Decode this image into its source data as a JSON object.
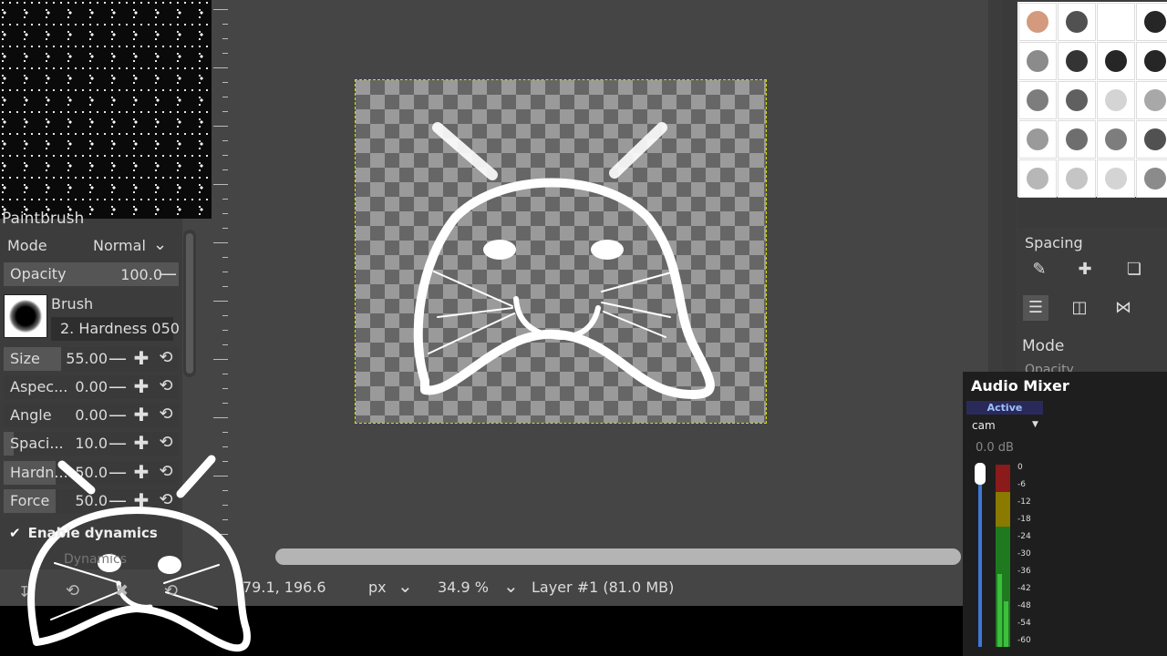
{
  "left_dock": {
    "title": "Paintbrush",
    "mode_label": "Mode",
    "mode_value": "Normal",
    "opacity_label": "Opacity",
    "opacity_value": "100.0",
    "brush_label": "Brush",
    "brush_name": "2. Hardness 050",
    "options": [
      {
        "label": "Size",
        "value": "55.00",
        "fill": 0.55
      },
      {
        "label": "Aspec...",
        "value": "0.00",
        "fill": 0.0
      },
      {
        "label": "Angle",
        "value": "0.00",
        "fill": 0.0
      },
      {
        "label": "Spaci...",
        "value": "10.0",
        "fill": 0.1
      },
      {
        "label": "Hardn...",
        "value": "50.0",
        "fill": 0.5
      },
      {
        "label": "Force",
        "value": "50.0",
        "fill": 0.5
      }
    ],
    "enable_dynamics": "Enable dynamics",
    "dynamics_label": "Dynamics"
  },
  "statusbar": {
    "coords": "79.1, 196.6",
    "unit": "px",
    "zoom": "34.9 %",
    "layer_info": "Layer #1 (81.0 MB)"
  },
  "right_dock": {
    "spacing_label": "Spacing",
    "mode_label": "Mode",
    "opacity_label": "Opacity"
  },
  "audio_mixer": {
    "title": "Audio Mixer",
    "status": "Active",
    "source": "cam",
    "level": "0.0 dB",
    "scale": [
      "0",
      "-6",
      "-12",
      "-18",
      "-24",
      "-30",
      "-36",
      "-42",
      "-48",
      "-54",
      "-60"
    ]
  },
  "colors": {
    "canvas_border": "#d8e000",
    "meter_green": "#3cbf3c",
    "meter_yellow": "#c8b400",
    "meter_red": "#b41e1e",
    "fader": "#3c78d8"
  },
  "icons": [
    "chevron-down-icon",
    "minus-icon",
    "plus-icon",
    "reset-icon",
    "check-icon",
    "edit-brush-icon",
    "new-brush-icon",
    "duplicate-brush-icon",
    "list-view-icon",
    "grid-view-icon",
    "ribbon-icon",
    "caret-down-icon"
  ]
}
